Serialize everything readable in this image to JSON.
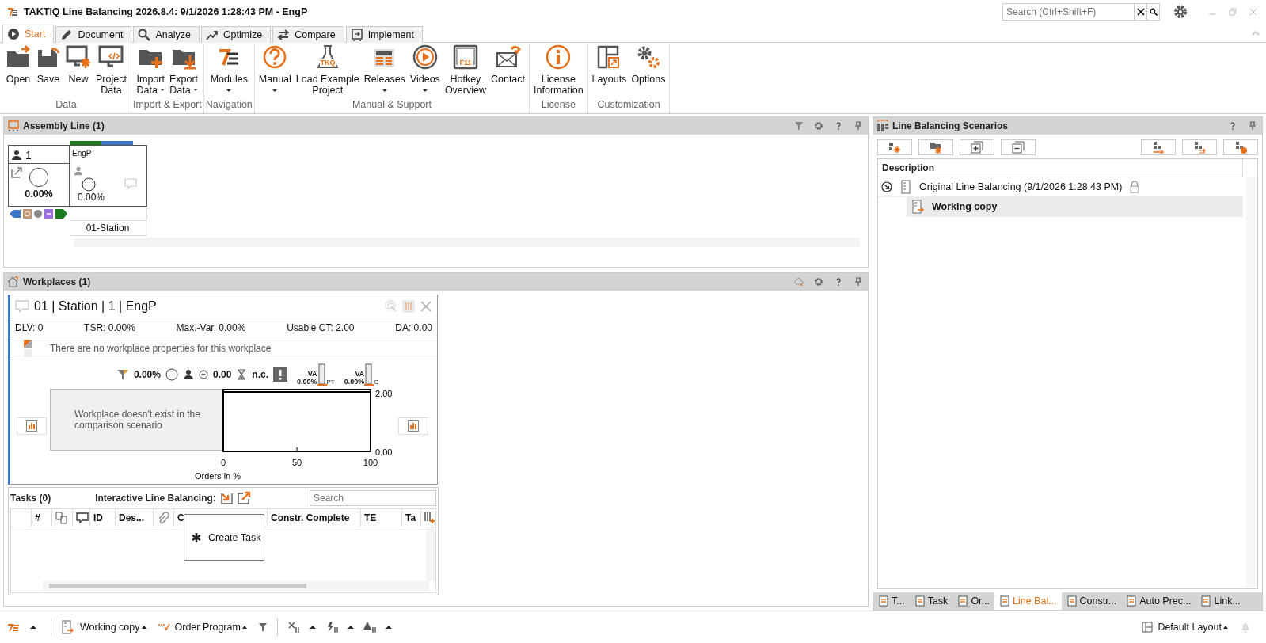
{
  "window": {
    "title": "TAKTIQ Line Balancing 2026.8.4: 9/1/2026 1:28:43 PM - EngP",
    "search": {
      "placeholder": "Search (Ctrl+Shift+F)"
    }
  },
  "ribbon_tabs": [
    {
      "label": "Start",
      "selected": true
    },
    {
      "label": "Document",
      "selected": false
    },
    {
      "label": "Analyze",
      "selected": false
    },
    {
      "label": "Optimize",
      "selected": false
    },
    {
      "label": "Compare",
      "selected": false
    },
    {
      "label": "Implement",
      "selected": false
    }
  ],
  "ribbon_groups": [
    {
      "label": "Data",
      "buttons": [
        {
          "lines": [
            "Open"
          ],
          "dropdown": false
        },
        {
          "lines": [
            "Save"
          ],
          "dropdown": false
        },
        {
          "lines": [
            "New"
          ],
          "dropdown": false
        },
        {
          "lines": [
            "Project",
            "Data"
          ],
          "dropdown": false
        }
      ]
    },
    {
      "label": "Import & Export",
      "buttons": [
        {
          "lines": [
            "Import",
            "Data"
          ],
          "dropdown": true
        },
        {
          "lines": [
            "Export",
            "Data"
          ],
          "dropdown": true
        }
      ]
    },
    {
      "label": "Navigation",
      "buttons": [
        {
          "lines": [
            "Modules"
          ],
          "dropdown": true
        }
      ]
    },
    {
      "label": "Manual & Support",
      "buttons": [
        {
          "lines": [
            "Manual"
          ],
          "dropdown": true
        },
        {
          "lines": [
            "Load Example",
            "Project"
          ],
          "dropdown": false,
          "badge": "TKQ"
        },
        {
          "lines": [
            "Releases"
          ],
          "dropdown": true
        },
        {
          "lines": [
            "Videos"
          ],
          "dropdown": true
        },
        {
          "lines": [
            "Hotkey",
            "Overview"
          ],
          "dropdown": false,
          "badge": "F11"
        },
        {
          "lines": [
            "Contact"
          ],
          "dropdown": false
        }
      ]
    },
    {
      "label": "License",
      "buttons": [
        {
          "lines": [
            "License",
            "Information"
          ],
          "dropdown": false
        }
      ]
    },
    {
      "label": "Customization",
      "buttons": [
        {
          "lines": [
            "Layouts"
          ],
          "dropdown": false
        },
        {
          "lines": [
            "Options"
          ],
          "dropdown": false
        }
      ]
    }
  ],
  "assembly_line": {
    "title": "Assembly Line (1)",
    "line_card": {
      "workers": "1",
      "utilization": "0.00%"
    },
    "stations": [
      {
        "name": "EngP",
        "utilization": "0.00%",
        "label": "01-Station"
      }
    ]
  },
  "workplaces": {
    "title": "Workplaces (1)",
    "card": {
      "title": "01 | Station | 1 | EngP",
      "metrics": [
        "DLV: 0",
        "TSR: 0.00%",
        "Max.-Var. 0.00%",
        "Usable CT: 2.00",
        "DA: 0.00"
      ],
      "properties_note": "There are no workplace properties for this workplace",
      "indicators": {
        "utilization": "0.00%",
        "time": "0.00",
        "status": "n.c.",
        "gauges": [
          {
            "label": "VA",
            "value": "0.00%",
            "suffix": "PT"
          },
          {
            "label": "VA",
            "value": "0.00%",
            "suffix": "C"
          }
        ]
      },
      "comparison_note": "Workplace doesn't exist in the comparison scenario",
      "chart_data": {
        "type": "line",
        "xlabel": "Orders in %",
        "x": [
          0,
          100
        ],
        "series": [
          {
            "color": "#000000",
            "values": [
              2,
              2
            ]
          }
        ],
        "xlim": [
          0,
          100
        ],
        "ylim": [
          0,
          2
        ],
        "xticks": [
          0,
          50,
          100
        ],
        "yticks": [
          {
            "value": 0,
            "label": "0.00"
          },
          {
            "value": 2,
            "label": "2.00"
          }
        ]
      }
    },
    "tasks": {
      "title": "Tasks (0)",
      "interactive_label": "Interactive Line Balancing:",
      "search": {
        "placeholder": "Search"
      },
      "columns": [
        {
          "kind": "blank"
        },
        {
          "kind": "text",
          "label": "#"
        },
        {
          "kind": "icon"
        },
        {
          "kind": "icon"
        },
        {
          "kind": "text",
          "label": "ID"
        },
        {
          "kind": "text",
          "label": "Des..."
        },
        {
          "kind": "icon"
        },
        {
          "kind": "text",
          "label": "C"
        },
        {
          "kind": "text",
          "label": "Constr. Complete"
        },
        {
          "kind": "text",
          "label": "TE"
        },
        {
          "kind": "text",
          "label": "Ta"
        }
      ],
      "context_menu": [
        {
          "label": "Create Task"
        }
      ]
    }
  },
  "scenarios": {
    "title": "Line Balancing Scenarios",
    "column": "Description",
    "tree": [
      {
        "label": "Original Line Balancing (9/1/2026 1:28:43 PM)",
        "locked": true,
        "selected": false,
        "children": [
          {
            "label": "Working copy",
            "locked": false,
            "selected": true
          }
        ]
      }
    ],
    "tabs": [
      {
        "label": "T...",
        "selected": false
      },
      {
        "label": "Task",
        "selected": false
      },
      {
        "label": "Or...",
        "selected": false
      },
      {
        "label": "Line Bal...",
        "selected": true
      },
      {
        "label": "Constr...",
        "selected": false
      },
      {
        "label": "Auto Prec...",
        "selected": false
      },
      {
        "label": "Link...",
        "selected": false
      }
    ]
  },
  "status_bar": {
    "scenario": "Working copy",
    "program": "Order Program",
    "layout": "Default Layout"
  }
}
